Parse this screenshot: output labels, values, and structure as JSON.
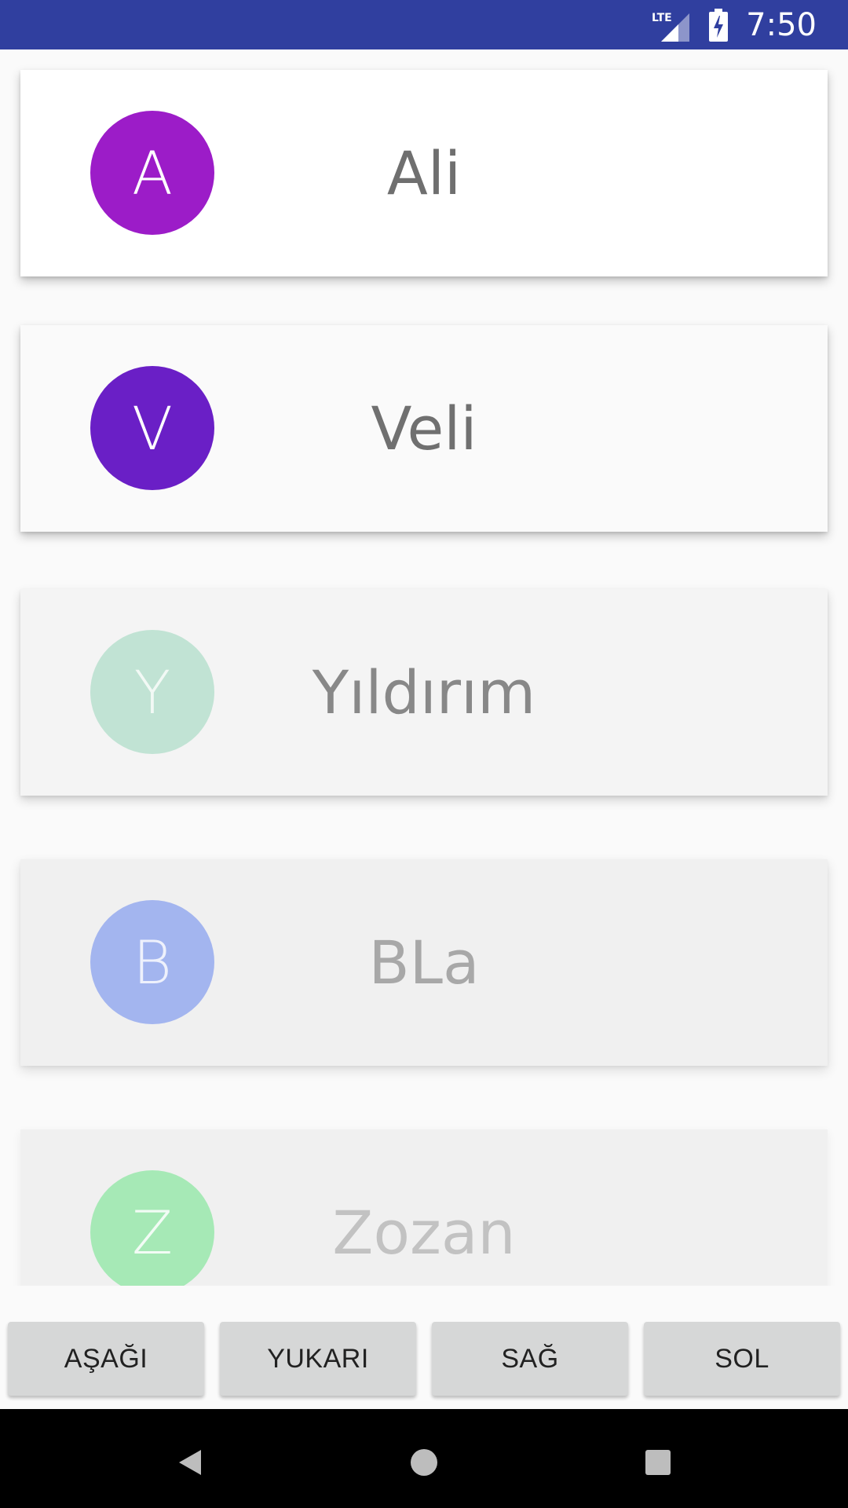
{
  "status_bar": {
    "network_label": "LTE",
    "time": "7:50",
    "icons": [
      "lte-signal-icon",
      "battery-charging-icon"
    ]
  },
  "list": {
    "items": [
      {
        "initial": "A",
        "name": "Ali",
        "avatar_color": "#9c1cc8",
        "card_bg": "#ffffff",
        "opacity": 1.0
      },
      {
        "initial": "V",
        "name": "Veli",
        "avatar_color": "#6a1fc6",
        "card_bg": "#fafafa",
        "opacity": 1.0
      },
      {
        "initial": "Y",
        "name": "Yıldırım",
        "avatar_color": "#a6dcc4",
        "card_bg": "#f5f5f5",
        "opacity": 0.75
      },
      {
        "initial": "B",
        "name": "BLa",
        "avatar_color": "#8aa3ee",
        "card_bg": "#f2f2f2",
        "opacity": 0.65
      },
      {
        "initial": "Z",
        "name": "Zozan",
        "avatar_color": "#7fe29d",
        "card_bg": "#f2f2f2",
        "opacity": 0.45
      }
    ]
  },
  "buttons": {
    "down": "AŞAĞI",
    "up": "YUKARI",
    "right": "SAĞ",
    "left": "SOL"
  },
  "nav_bar": {
    "icons": [
      "back-icon",
      "home-icon",
      "recents-icon"
    ]
  }
}
